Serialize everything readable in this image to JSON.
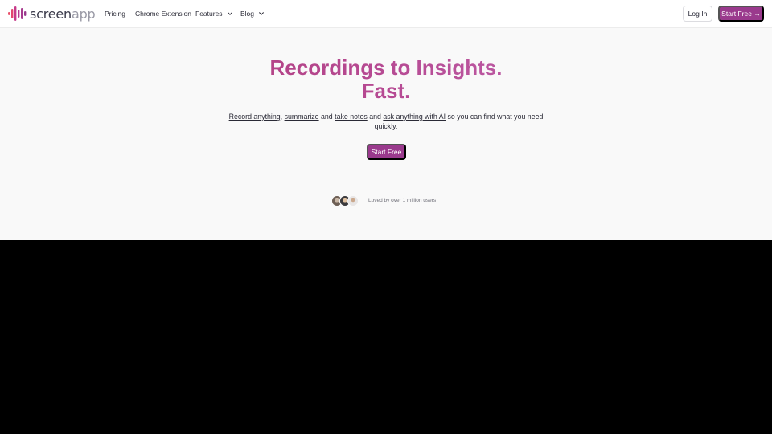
{
  "brand": {
    "name_primary": "screen",
    "name_secondary": "app",
    "colors": {
      "accent": "#9a3a8d",
      "gradient_start": "#b0366f",
      "gradient_end": "#c774bf",
      "logo_bars": [
        "#e94f6a",
        "#c63a8a",
        "#9a3a8d"
      ]
    }
  },
  "nav": {
    "links": [
      {
        "label": "Pricing"
      },
      {
        "label": "Chrome Extension"
      },
      {
        "label": "Features",
        "icon": "chevron-down-icon"
      },
      {
        "label": "Blog",
        "icon": "chevron-down-icon"
      }
    ],
    "login_label": "Log In",
    "start_label": "Start Free →"
  },
  "hero": {
    "title_line1": "Recordings to Insights.",
    "title_line2": "Fast.",
    "subtitle": {
      "link1": "Record anything",
      "sep1": ", ",
      "link2": "summarize",
      "sep2": " and ",
      "link3": "take notes",
      "sep3": " and ",
      "link4": "ask anything with AI",
      "tail": " so you can find what you need quickly."
    },
    "cta_label": "Start Free"
  },
  "social_proof": {
    "text": "Loved by over 1 million users"
  }
}
